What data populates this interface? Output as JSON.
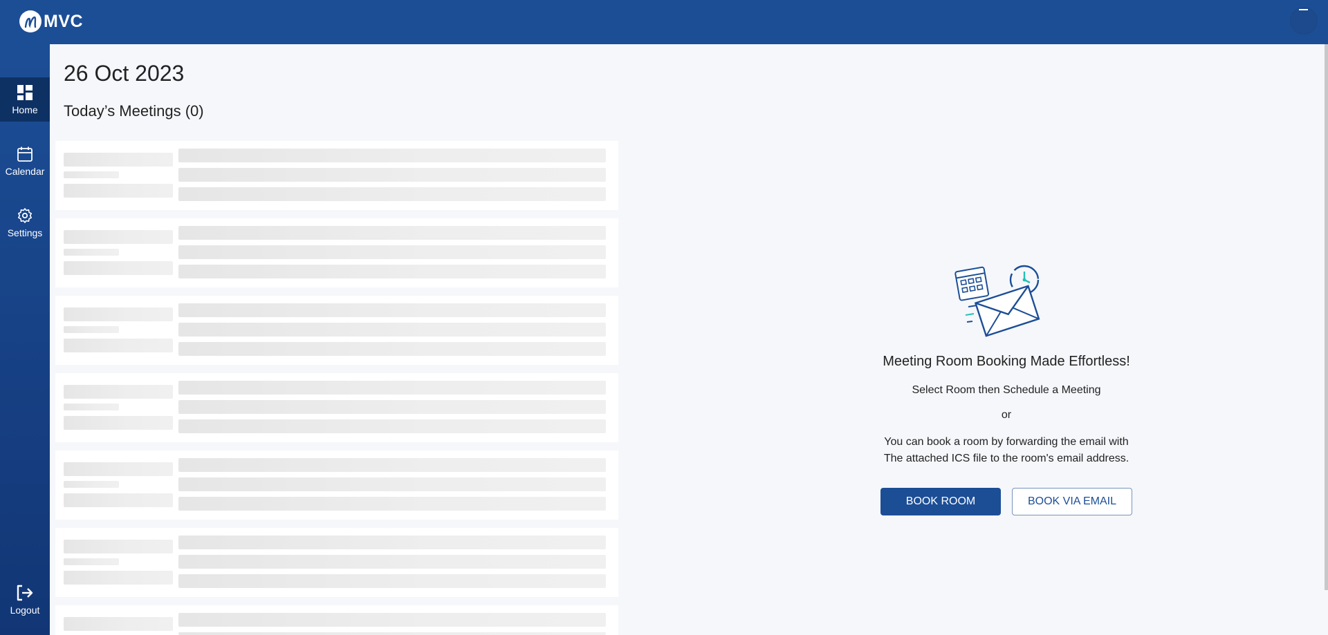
{
  "app": {
    "logo_text": "MVC"
  },
  "sidebar": {
    "items": [
      {
        "label": "Home",
        "icon": "dashboard-icon",
        "active": true
      },
      {
        "label": "Calendar",
        "icon": "calendar-icon",
        "active": false
      },
      {
        "label": "Settings",
        "icon": "gear-icon",
        "active": false
      }
    ],
    "logout_label": "Logout"
  },
  "main": {
    "date": "26 Oct 2023",
    "meetings_title": "Today’s Meetings (0)"
  },
  "promo": {
    "title": "Meeting Room Booking Made Effortless!",
    "line1": "Select Room then Schedule a Meeting",
    "or": "or",
    "line2a": "You can book a room by forwarding the email with",
    "line2b": "The attached ICS file to the room's email address.",
    "book_room_label": "BOOK ROOM",
    "book_email_label": "BOOK VIA EMAIL"
  },
  "colors": {
    "primary": "#1c4e96",
    "active_nav": "#0e3164",
    "background": "#f5f7fb",
    "accent": "#22c1b5"
  }
}
